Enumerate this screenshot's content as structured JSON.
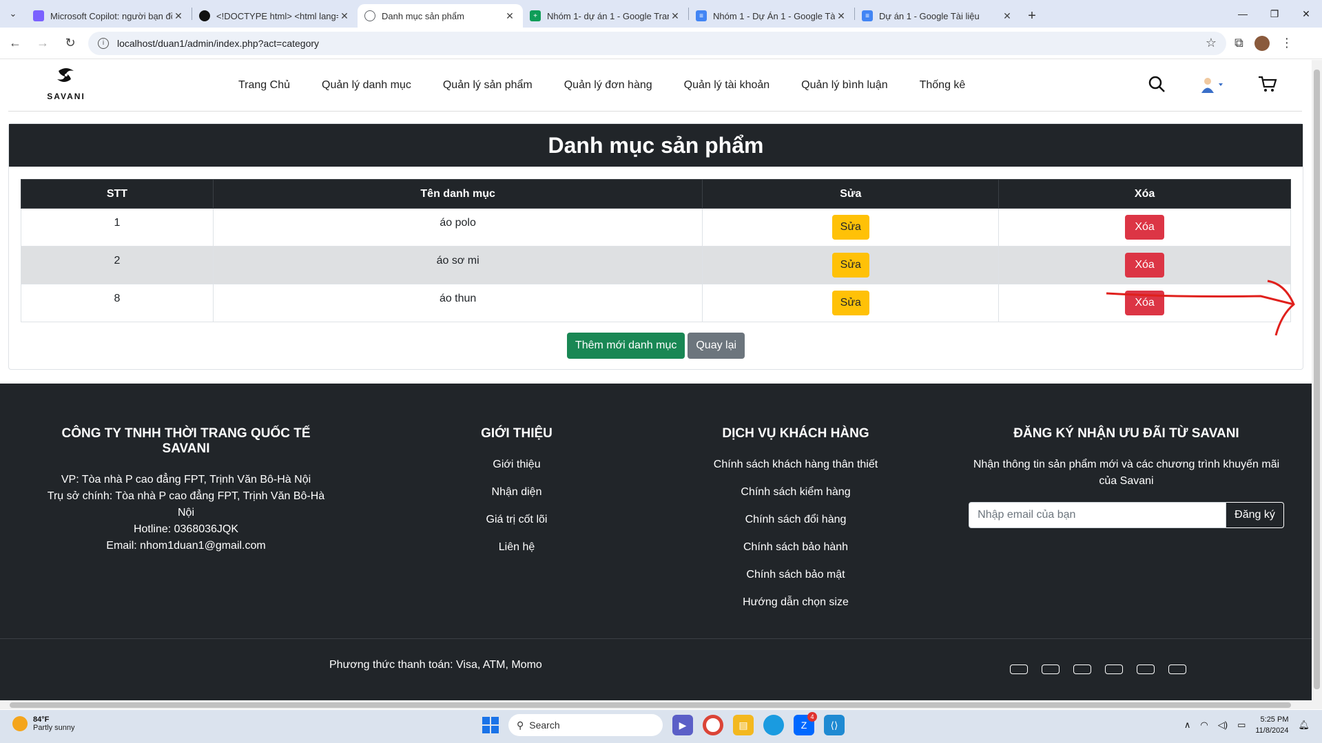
{
  "browser": {
    "tabs": [
      {
        "title": "Microsoft Copilot: người bạn đồ",
        "favicon_color": "#7b61ff",
        "active": false
      },
      {
        "title": "<!DOCTYPE html> <html lang=",
        "favicon_color": "#111111",
        "active": false
      },
      {
        "title": "Danh mục sản phẩm",
        "favicon_color": "#5f6368",
        "active": true
      },
      {
        "title": "Nhóm 1- dự án 1 - Google Tran",
        "favicon_color": "#0f9d58",
        "active": false
      },
      {
        "title": "Nhóm 1 - Dự Án 1 - Google Tài",
        "favicon_color": "#4285f4",
        "active": false
      },
      {
        "title": "Dự án 1 - Google Tài liệu",
        "favicon_color": "#4285f4",
        "active": false
      }
    ],
    "url": "localhost/duan1/admin/index.php?act=category"
  },
  "site": {
    "logo_text": "SAVANI",
    "nav": [
      "Trang Chủ",
      "Quản lý danh mục",
      "Quản lý sản phẩm",
      "Quản lý đơn hàng",
      "Quản lý tài khoản",
      "Quản lý bình luận",
      "Thống kê"
    ]
  },
  "category": {
    "heading": "Danh mục sản phẩm",
    "columns": {
      "stt": "STT",
      "name": "Tên danh mục",
      "edit": "Sửa",
      "delete": "Xóa"
    },
    "rows": [
      {
        "stt": "1",
        "name": "áo polo",
        "edit_label": "Sửa",
        "delete_label": "Xóa"
      },
      {
        "stt": "2",
        "name": "áo sơ mi",
        "edit_label": "Sửa",
        "delete_label": "Xóa"
      },
      {
        "stt": "8",
        "name": "áo thun",
        "edit_label": "Sửa",
        "delete_label": "Xóa"
      }
    ],
    "add_label": "Thêm mới danh mục",
    "back_label": "Quay lại"
  },
  "footer": {
    "company": {
      "title": "CÔNG TY TNHH THỜI TRANG QUỐC TẾ SAVANI",
      "lines": [
        "VP: Tòa nhà P cao đẳng FPT, Trịnh Văn Bô-Hà Nội",
        "Trụ sở chính: Tòa nhà P cao đẳng FPT, Trịnh Văn Bô-Hà Nội",
        "Hotline: 0368036JQK",
        "Email: nhom1duan1@gmail.com"
      ]
    },
    "about": {
      "title": "GIỚI THIỆU",
      "links": [
        "Giới thiệu",
        "Nhận diện",
        "Giá trị cốt lõi",
        "Liên hệ"
      ]
    },
    "service": {
      "title": "DỊCH VỤ KHÁCH HÀNG",
      "links": [
        "Chính sách khách hàng thân thiết",
        "Chính sách kiểm hàng",
        "Chính sách đổi hàng",
        "Chính sách bảo hành",
        "Chính sách bảo mật",
        "Hướng dẫn chọn size"
      ]
    },
    "subscribe": {
      "title": "ĐĂNG KÝ NHẬN ƯU ĐÃI TỪ SAVANI",
      "desc": "Nhận thông tin sản phẩm mới và các chương trình khuyến mãi của Savani",
      "placeholder": "Nhập email của bạn",
      "button": "Đăng ký"
    },
    "payment": "Phương thức thanh toán: Visa, ATM, Momo"
  },
  "taskbar": {
    "weather_temp": "84°F",
    "weather_desc": "Partly sunny",
    "search_placeholder": "Search",
    "time": "5:25 PM",
    "date": "11/8/2024",
    "zalo_badge": "4"
  },
  "colors": {
    "dark": "#212529",
    "warning": "#ffc107",
    "danger": "#dc3545",
    "success": "#198754",
    "secondary": "#6c757d",
    "annotation": "#e0201c"
  }
}
